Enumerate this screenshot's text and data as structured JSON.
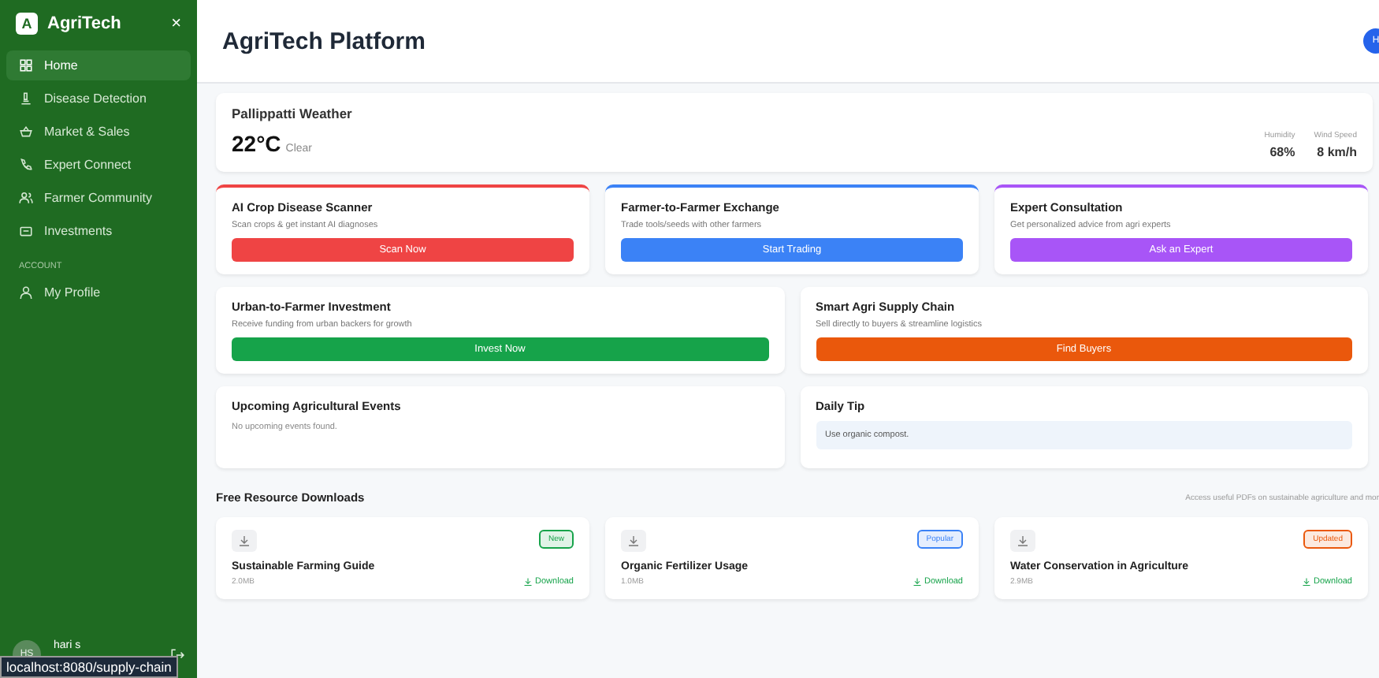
{
  "sidebar": {
    "logo": "A",
    "title": "AgriTech",
    "close": "×",
    "items": [
      {
        "label": "Home",
        "selected": true
      },
      {
        "label": "Disease Detection",
        "selected": false
      },
      {
        "label": "Market & Sales",
        "selected": false
      },
      {
        "label": "Expert Connect",
        "selected": false
      },
      {
        "label": "Farmer Community",
        "selected": false
      },
      {
        "label": "Investments",
        "selected": false
      }
    ],
    "section": "ACCOUNT",
    "account_items": [
      {
        "label": "My Profile",
        "selected": false
      }
    ],
    "user": {
      "initials": "HS",
      "name": "hari s"
    }
  },
  "header": {
    "title": "AgriTech Platform",
    "avatar": "H"
  },
  "weather": {
    "title": "Pallippatti Weather",
    "temperature": "22°C",
    "condition": "Clear",
    "stats": [
      {
        "label": "Humidity",
        "value": "68%"
      },
      {
        "label": "Wind Speed",
        "value": "8 km/h"
      }
    ]
  },
  "feature_cards": [
    {
      "title": "AI Crop Disease Scanner",
      "description": "Scan crops & get instant AI diagnoses",
      "button": "Scan Now",
      "color": "#ef4444",
      "top_border": true
    },
    {
      "title": "Farmer-to-Farmer Exchange",
      "description": "Trade tools/seeds with other farmers",
      "button": "Start Trading",
      "color": "#3b82f6",
      "top_border": true
    },
    {
      "title": "Expert Consultation",
      "description": "Get personalized advice from agri experts",
      "button": "Ask an Expert",
      "color": "#a855f7",
      "top_border": true
    },
    {
      "title": "Urban-to-Farmer Investment",
      "description": "Receive funding from urban backers for growth",
      "button": "Invest Now",
      "color": "#16a34a",
      "top_border": false
    },
    {
      "title": "Smart Agri Supply Chain",
      "description": "Sell directly to buyers & streamline logistics",
      "button": "Find Buyers",
      "color": "#ea580c",
      "top_border": false
    }
  ],
  "events": {
    "title": "Upcoming Agricultural Events",
    "empty_text": "No upcoming events found."
  },
  "daily_tip": {
    "title": "Daily Tip",
    "tip": "Use organic compost."
  },
  "downloads": {
    "title": "Free Resource Downloads",
    "subtitle": "Access useful PDFs on sustainable agriculture and mor",
    "items": [
      {
        "title": "Sustainable Farming Guide",
        "size": "2.0MB",
        "badge": "New",
        "color": "#16a34a",
        "link": "Download"
      },
      {
        "title": "Organic Fertilizer Usage",
        "size": "1.0MB",
        "badge": "Popular",
        "color": "#3b82f6",
        "link": "Download"
      },
      {
        "title": "Water Conservation in Agriculture",
        "size": "2.9MB",
        "badge": "Updated",
        "color": "#ea580c",
        "link": "Download"
      }
    ]
  },
  "status_url": "localhost:8080/supply-chain"
}
